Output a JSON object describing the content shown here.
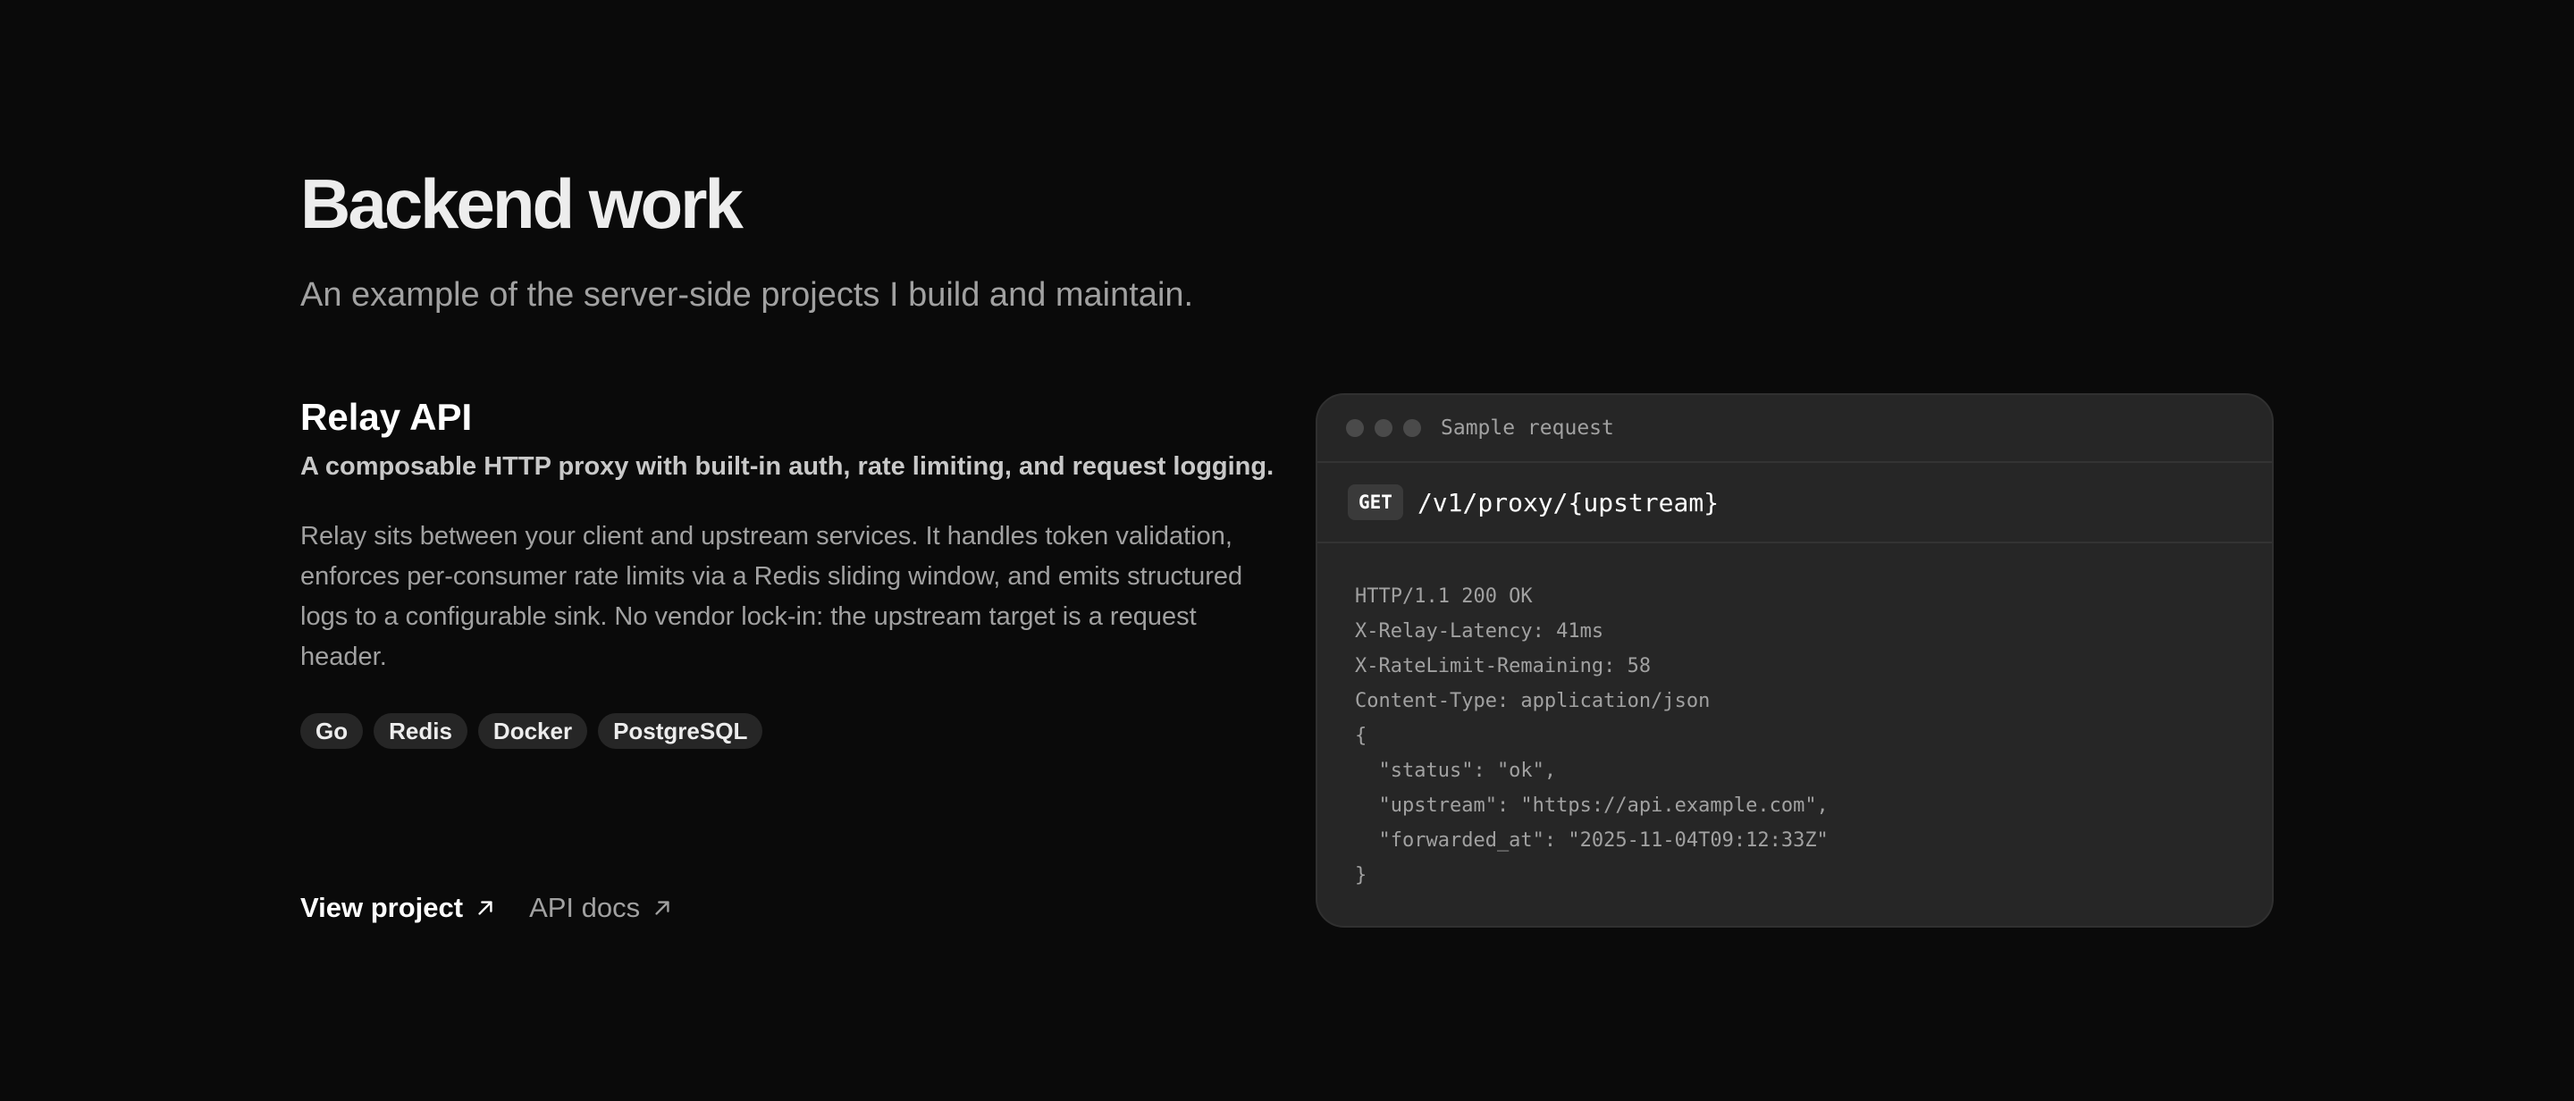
{
  "section": {
    "title": "Backend work",
    "subtitle": "An example of the server-side projects I build and maintain."
  },
  "project": {
    "name": "Relay API",
    "tagline": "A composable HTTP proxy with built-in auth, rate limiting, and request logging.",
    "description": "Relay sits between your client and upstream services. It handles token validation, enforces per-consumer rate limits via a Redis sliding window, and emits structured logs to a configurable sink. No vendor lock-in: the upstream target is a request header.",
    "tags": [
      "Go",
      "Redis",
      "Docker",
      "PostgreSQL"
    ],
    "links": {
      "view_project": "View project",
      "api_docs": "API docs",
      "icon": "arrow-up-right-icon"
    }
  },
  "sample": {
    "title": "Sample request",
    "method": "GET",
    "path": "/v1/proxy/{upstream}",
    "response_lines": [
      "HTTP/1.1 200 OK",
      "X-Relay-Latency: 41ms",
      "X-RateLimit-Remaining: 58",
      "Content-Type: application/json",
      "{",
      "  \"status\": \"ok\",",
      "  \"upstream\": \"https://api.example.com\",",
      "  \"forwarded_at\": \"2025-11-04T09:12:33Z\"",
      "}"
    ]
  },
  "colors": {
    "background": "#0a0a0a",
    "panel": "#262626",
    "text_primary": "#ededed",
    "text_muted": "#a1a1a1"
  }
}
